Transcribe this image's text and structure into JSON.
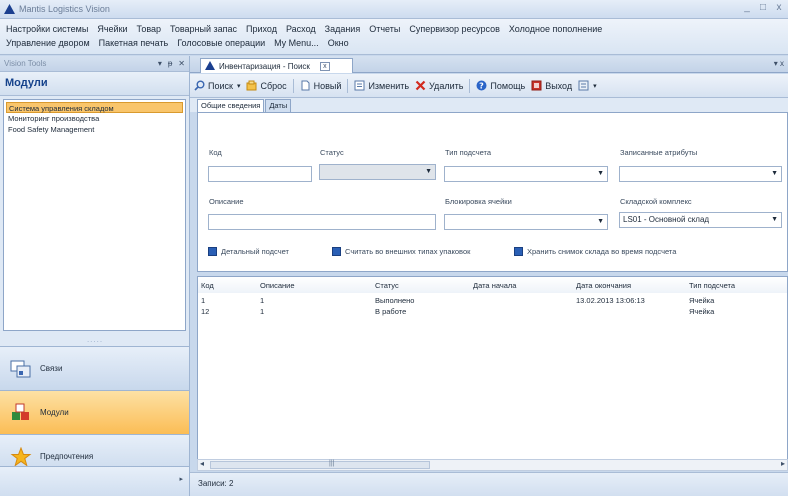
{
  "window": {
    "title": "Mantis Logistics Vision",
    "controls": [
      "_",
      "□",
      "x"
    ]
  },
  "menu": {
    "row1": [
      "Настройки системы",
      "Ячейки",
      "Товар",
      "Товарный запас",
      "Приход",
      "Расход",
      "Задания",
      "Отчеты",
      "Супервизор ресурсов",
      "Холодное пополнение"
    ],
    "row2": [
      "Управление двором",
      "Пакетная печать",
      "Голосовые операции",
      "My Menu...",
      "Окно"
    ]
  },
  "left_panel": {
    "header": "Vision Tools",
    "header_controls": [
      "▾",
      "ᵽ",
      "✕"
    ],
    "title": "Модули",
    "modules": [
      "Система управления складом",
      "Мониторинг производства",
      "Food Safety Management"
    ],
    "selected_index": 0,
    "splitter": ".....",
    "nav": [
      {
        "label": "Связи",
        "icon": "links-icon"
      },
      {
        "label": "Модули",
        "icon": "modules-icon",
        "active": true
      },
      {
        "label": "Предпочтения",
        "icon": "star-icon"
      }
    ],
    "bottom_arrow": "▸"
  },
  "doc_tab": {
    "label": "Инвентаризация - Поиск",
    "close": "x",
    "tabs_arrow": "▾ x"
  },
  "toolbar": {
    "search": "Поиск",
    "reset": "Сброс",
    "new": "Новый",
    "edit": "Изменить",
    "delete": "Удалить",
    "help": "Помощь",
    "exit": "Выход"
  },
  "subtabs": [
    "Общие сведения",
    "Даты"
  ],
  "form": {
    "code_label": "Код",
    "code_value": "",
    "status_label": "Статус",
    "status_value": "",
    "count_type_label": "Тип подсчета",
    "count_type_value": "",
    "recorded_attrs_label": "Записанные атрибуты",
    "recorded_attrs_value": "",
    "description_label": "Описание",
    "description_value": "",
    "cell_lock_label": "Блокировка ячейки",
    "cell_lock_value": "",
    "warehouse_label": "Складской комплекс",
    "warehouse_value": "LS01 - Основной склад",
    "check1": "Детальный подсчет",
    "check2": "Считать во внешних типах упаковок",
    "check3": "Хранить снимок склада во время подсчета"
  },
  "grid": {
    "columns": [
      "Код",
      "Описание",
      "Статус",
      "Дата начала",
      "Дата окончания",
      "Тип подсчета"
    ],
    "rows": [
      [
        "1",
        "1",
        "Выполнено",
        "",
        "13.02.2013 13:06:13",
        "Ячейка"
      ],
      [
        "12",
        "1",
        "В работе",
        "",
        "",
        "Ячейка"
      ]
    ]
  },
  "scrollbar": {
    "left": "◂",
    "right": "▸",
    "grip": "|||"
  },
  "status": {
    "records": "Записи: 2"
  }
}
